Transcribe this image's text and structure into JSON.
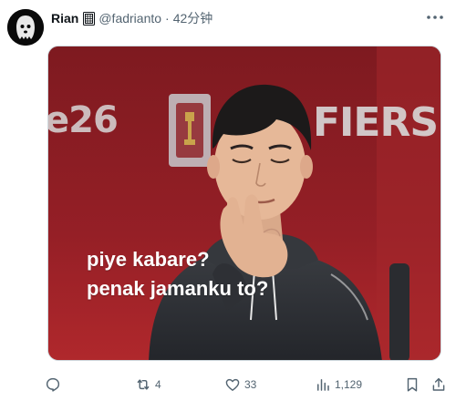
{
  "tweet": {
    "author": {
      "display_name": "Rian",
      "handle": "@fadrianto",
      "separator": "·",
      "time": "42分钟"
    },
    "media": {
      "caption_lines": [
        "piye kabare?",
        "penak jamanku to?"
      ],
      "background_text_left": "e26",
      "background_text_right": "FIERS"
    },
    "actions": {
      "reply_count": "",
      "retweet_count": "4",
      "like_count": "33",
      "view_count": "1,129"
    },
    "icons": {
      "avatar": "ghost-avatar-icon",
      "more": "more-options-icon",
      "reply": "reply-icon",
      "retweet": "retweet-icon",
      "like": "heart-icon",
      "views": "views-icon",
      "bookmark": "bookmark-icon",
      "share": "share-icon"
    },
    "colors": {
      "text_primary": "#0f1419",
      "text_secondary": "#536471",
      "media_background": "#8c1f24"
    }
  }
}
